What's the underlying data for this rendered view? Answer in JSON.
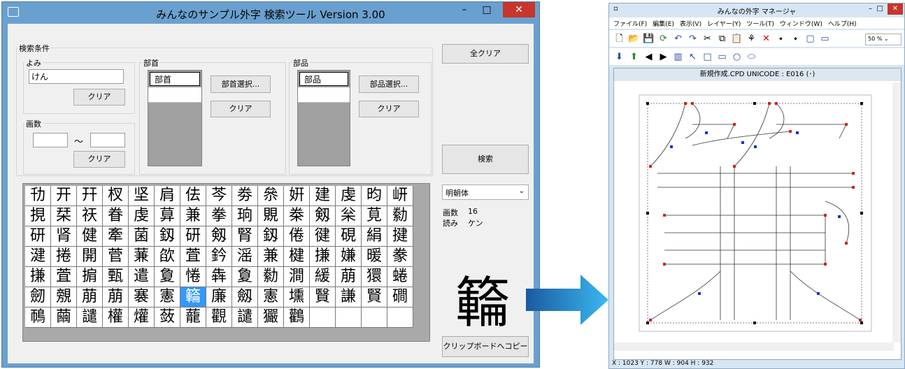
{
  "search_window": {
    "title": "みんなのサンプル外字 検索ツール Version 3.00",
    "criteria_label": "検索条件",
    "yomi_label": "よみ",
    "yomi_value": "けん",
    "clear_label": "クリア",
    "kakusu_label": "画数",
    "tilde": "～",
    "bushu_label": "部首",
    "bushu_item": "部首",
    "bushu_select_label": "部首選択...",
    "buhin_label": "部品",
    "buhin_item": "部品",
    "buhin_select_label": "部品選択...",
    "all_clear_label": "全クリア",
    "search_label": "検索",
    "font_select": "明朝体",
    "kakusu_info_label": "画数",
    "kakusu_info_value": "16",
    "yomi_info_label": "読み",
    "yomi_info_value": "ケン",
    "preview_char": "𥶡",
    "copy_label": "クリップボードへコピー",
    "chars": [
      "㔓",
      "开",
      "幵",
      "杈",
      "坚",
      "肩",
      "佉",
      "芩",
      "劵",
      "㕘",
      "姸",
      "建",
      "虔",
      "昀",
      "岍",
      "挸",
      "栞",
      "祆",
      "眷",
      "虔",
      "萛",
      "兼",
      "拳",
      "珦",
      "覞",
      "桊",
      "剱",
      "枀",
      "莧",
      "勬",
      "研",
      "肾",
      "健",
      "牽",
      "菌",
      "釼",
      "研",
      "剱",
      "腎",
      "釼",
      "倦",
      "徤",
      "硯",
      "絹",
      "揵",
      "湕",
      "捲",
      "開",
      "菅",
      "蒹",
      "欿",
      "萓",
      "鈐",
      "滛",
      "兼",
      "楗",
      "搛",
      "嫌",
      "暖",
      "豢",
      "搛",
      "萓",
      "掮",
      "甄",
      "遣",
      "夐",
      "惓",
      "犇",
      "夐",
      "勬",
      "澗",
      "緩",
      "萠",
      "獧",
      "蜷",
      "劒",
      "覫",
      "萠",
      "萠",
      "褰",
      "憲",
      "𥶡",
      "廉",
      "劔",
      "憲",
      "壎",
      "贀",
      "謙",
      "賢",
      "磵",
      "鳾",
      "繭",
      "譴",
      "權",
      "爟",
      "蔹",
      "蘢",
      "觀",
      "譴",
      "玁",
      "鸛"
    ]
  },
  "manager_window": {
    "title": "みんなの外字 マネージャ",
    "menus": [
      "ファイル(F)",
      "編集(E)",
      "表示(V)",
      "レイヤー(Y)",
      "ツール(T)",
      "ウィンドウ(W)",
      "ヘルプ(H)"
    ],
    "zoom": "50 %",
    "doc_title": "新規作成.CPD UNICODE : E016 (･)",
    "status": "X : 1023   Y : 778    W : 904   H : 932"
  }
}
